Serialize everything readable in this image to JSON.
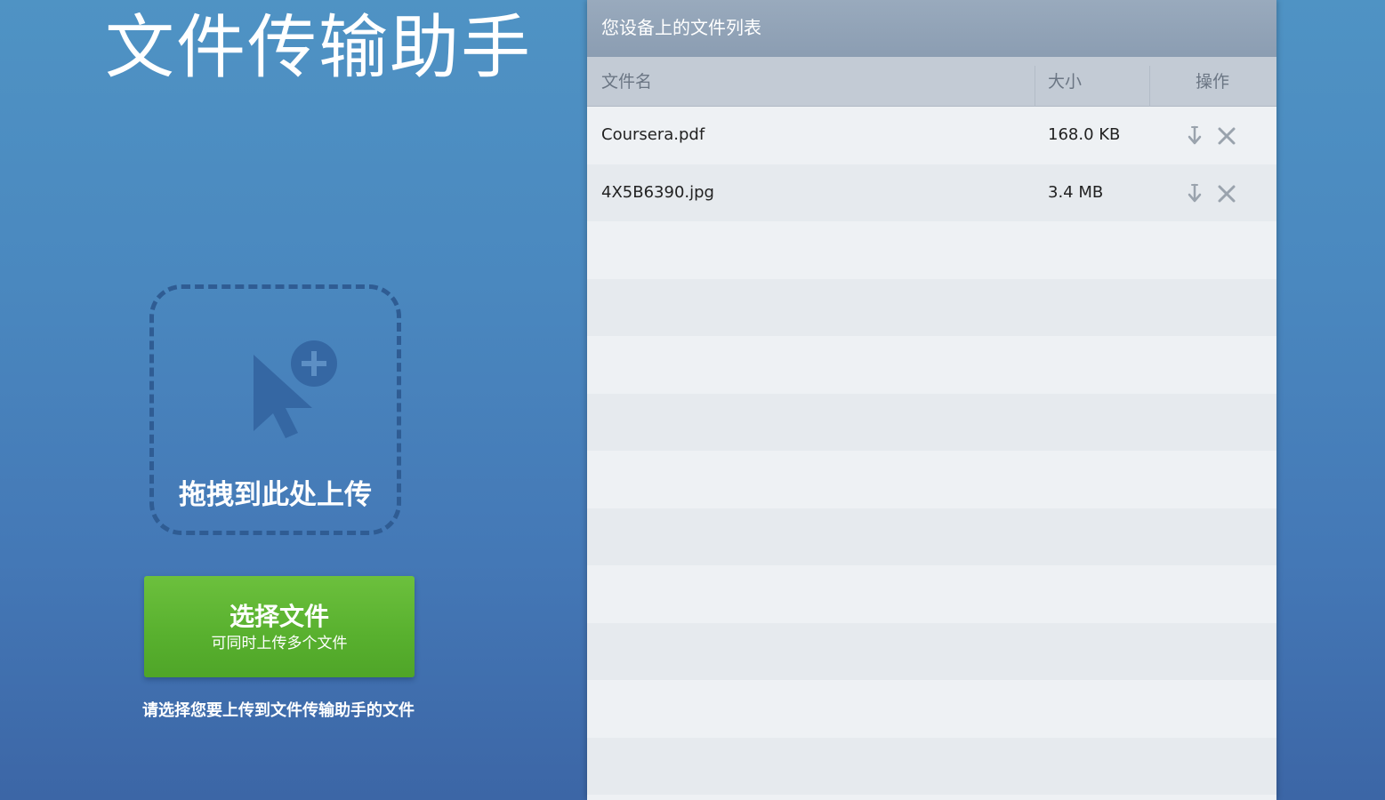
{
  "app": {
    "title": "文件传输助手"
  },
  "upload": {
    "drop_label": "拖拽到此处上传",
    "select_button_title": "选择文件",
    "select_button_sub": "可同时上传多个文件",
    "hint": "请选择您要上传到文件传输助手的文件"
  },
  "file_list": {
    "header": "您设备上的文件列表",
    "columns": {
      "name": "文件名",
      "size": "大小",
      "action": "操作"
    },
    "files": [
      {
        "name": "Coursera.pdf",
        "size": "168.0 KB"
      },
      {
        "name": "4X5B6390.jpg",
        "size": "3.4 MB"
      }
    ]
  },
  "colors": {
    "background_top": "#4f93c4",
    "background_bottom": "#3c66a6",
    "button_green": "#58b02e",
    "panel_header": "#8b9db2",
    "icon_gray": "#9aa3ad"
  },
  "icons": {
    "drop": "cursor-plus-icon",
    "download": "download-icon",
    "delete": "close-icon"
  }
}
